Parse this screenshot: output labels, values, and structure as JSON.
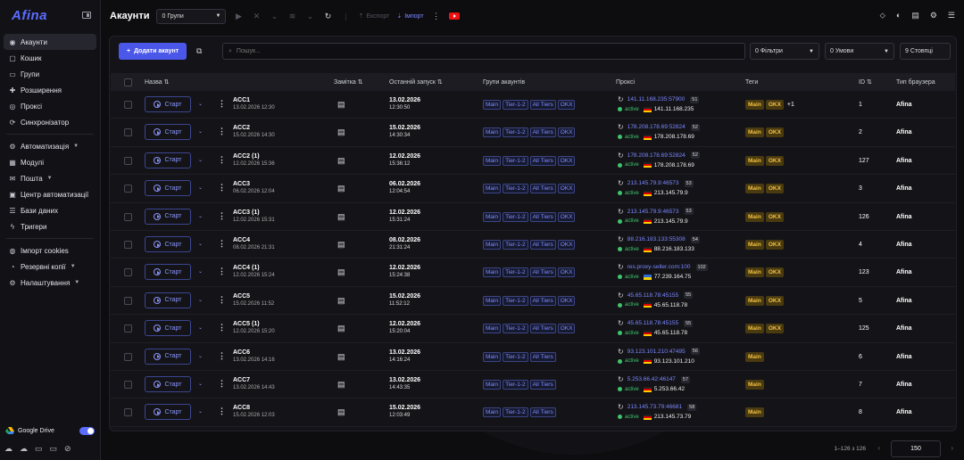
{
  "sidebar": {
    "logo": "Afina",
    "items": [
      {
        "label": "Акаунти",
        "icon": "user-icon",
        "active": true
      },
      {
        "label": "Кошик",
        "icon": "trash-icon"
      },
      {
        "label": "Групи",
        "icon": "folder-icon"
      },
      {
        "label": "Розширення",
        "icon": "puzzle-icon"
      },
      {
        "label": "Проксі",
        "icon": "globe-icon"
      },
      {
        "label": "Синхронізатор",
        "icon": "sync-icon"
      },
      {
        "label": "Автоматизація",
        "icon": "robot-icon",
        "has_chevron": true
      },
      {
        "label": "Модулі",
        "icon": "module-icon"
      },
      {
        "label": "Пошта",
        "icon": "mail-icon",
        "has_chevron": true
      },
      {
        "label": "Центр автоматизації",
        "icon": "hub-icon"
      },
      {
        "label": "Бази даних",
        "icon": "database-icon"
      },
      {
        "label": "Тригери",
        "icon": "bolt-icon"
      },
      {
        "label": "Імпорт cookies",
        "icon": "cookie-icon"
      },
      {
        "label": "Резервні копії",
        "icon": "backup-icon",
        "has_chevron": true
      },
      {
        "label": "Налаштування",
        "icon": "settings-icon",
        "has_chevron": true
      }
    ],
    "google_drive": {
      "label": "Google Drive",
      "enabled": true
    }
  },
  "topbar": {
    "title": "Акаунти",
    "group_select": "0 Групи",
    "export_label": "Експорт",
    "import_label": "Імпорт"
  },
  "toolbar": {
    "add_label": "Додати акаунт",
    "search_placeholder": "Пошук...",
    "filters": "0 Фільтри",
    "conditions": "0 Умови",
    "columns": "9 Стовпці"
  },
  "table": {
    "headers": {
      "name": "Назва",
      "note": "Замітка",
      "last_run": "Останній запуск",
      "groups": "Групи акаунтів",
      "proxy": "Проксі",
      "tags": "Теги",
      "id": "ID",
      "browser": "Тип браузера"
    },
    "start_label": "Старт",
    "status_label": "active",
    "rows": [
      {
        "name": "ACC1",
        "created": "13.02.2026 12:30",
        "run_date": "13.02.2026",
        "run_time": "12:30:50",
        "groups": [
          "Main",
          "Tier-1-2",
          "All Tiers",
          "OKX"
        ],
        "proxy": "141.11.168.235:57900",
        "pn": "51",
        "ip": "141.11.168.235",
        "flag": "de",
        "tags": [
          "Main",
          "OKX"
        ],
        "more": "+1",
        "id": "1",
        "browser": "Afina"
      },
      {
        "name": "ACC2",
        "created": "15.02.2026 14:30",
        "run_date": "15.02.2026",
        "run_time": "14:30:34",
        "groups": [
          "Main",
          "Tier-1-2",
          "All Tiers",
          "OKX"
        ],
        "proxy": "178.208.178.69:52824",
        "pn": "52",
        "ip": "178.208.178.69",
        "flag": "de",
        "tags": [
          "Main",
          "OKX"
        ],
        "more": "",
        "id": "2",
        "browser": "Afina"
      },
      {
        "name": "ACC2 (1)",
        "created": "12.02.2026 15:36",
        "run_date": "12.02.2026",
        "run_time": "15:36:12",
        "groups": [
          "Main",
          "Tier-1-2",
          "All Tiers",
          "OKX"
        ],
        "proxy": "178.208.178.69:52824",
        "pn": "52",
        "ip": "178.208.178.69",
        "flag": "de",
        "tags": [
          "Main",
          "OKX"
        ],
        "more": "",
        "id": "127",
        "browser": "Afina"
      },
      {
        "name": "ACC3",
        "created": "06.02.2026 12:04",
        "run_date": "06.02.2026",
        "run_time": "12:04:54",
        "groups": [
          "Main",
          "Tier-1-2",
          "All Tiers",
          "OKX"
        ],
        "proxy": "213.145.79.9:46573",
        "pn": "53",
        "ip": "213.145.79.9",
        "flag": "de",
        "tags": [
          "Main",
          "OKX"
        ],
        "more": "",
        "id": "3",
        "browser": "Afina"
      },
      {
        "name": "ACC3 (1)",
        "created": "12.02.2026 15:31",
        "run_date": "12.02.2026",
        "run_time": "15:31:24",
        "groups": [
          "Main",
          "Tier-1-2",
          "All Tiers",
          "OKX"
        ],
        "proxy": "213.145.79.9:46573",
        "pn": "53",
        "ip": "213.145.79.9",
        "flag": "de",
        "tags": [
          "Main",
          "OKX"
        ],
        "more": "",
        "id": "126",
        "browser": "Afina"
      },
      {
        "name": "ACC4",
        "created": "08.02.2026 21:31",
        "run_date": "08.02.2026",
        "run_time": "21:31:24",
        "groups": [
          "Main",
          "Tier-1-2",
          "All Tiers",
          "OKX"
        ],
        "proxy": "88.216.183.133:55308",
        "pn": "54",
        "ip": "88.216.183.133",
        "flag": "de",
        "tags": [
          "Main",
          "OKX"
        ],
        "more": "",
        "id": "4",
        "browser": "Afina"
      },
      {
        "name": "ACC4 (1)",
        "created": "12.02.2026 15:24",
        "run_date": "12.02.2026",
        "run_time": "15:24:38",
        "groups": [
          "Main",
          "Tier-1-2",
          "All Tiers",
          "OKX"
        ],
        "proxy": "res.proxy-seller.com:100",
        "pn": "102",
        "ip": "77.239.164.75",
        "flag": "ua",
        "tags": [
          "Main",
          "OKX"
        ],
        "more": "",
        "id": "123",
        "browser": "Afina"
      },
      {
        "name": "ACC5",
        "created": "15.02.2026 11:52",
        "run_date": "15.02.2026",
        "run_time": "11:52:12",
        "groups": [
          "Main",
          "Tier-1-2",
          "All Tiers",
          "OKX"
        ],
        "proxy": "45.65.118.78:45155",
        "pn": "55",
        "ip": "45.65.118.78",
        "flag": "de",
        "tags": [
          "Main",
          "OKX"
        ],
        "more": "",
        "id": "5",
        "browser": "Afina"
      },
      {
        "name": "ACC5 (1)",
        "created": "12.02.2026 15:20",
        "run_date": "12.02.2026",
        "run_time": "15:20:04",
        "groups": [
          "Main",
          "Tier-1-2",
          "All Tiers",
          "OKX"
        ],
        "proxy": "45.65.118.78:45155",
        "pn": "55",
        "ip": "45.65.118.78",
        "flag": "de",
        "tags": [
          "Main",
          "OKX"
        ],
        "more": "",
        "id": "125",
        "browser": "Afina"
      },
      {
        "name": "ACC6",
        "created": "13.02.2026 14:16",
        "run_date": "13.02.2026",
        "run_time": "14:16:24",
        "groups": [
          "Main",
          "Tier-1-2",
          "All Tiers"
        ],
        "proxy": "93.123.101.210:47495",
        "pn": "56",
        "ip": "93.123.101.210",
        "flag": "de",
        "tags": [
          "Main"
        ],
        "more": "",
        "id": "6",
        "browser": "Afina"
      },
      {
        "name": "ACC7",
        "created": "13.02.2026 14:43",
        "run_date": "13.02.2026",
        "run_time": "14:43:35",
        "groups": [
          "Main",
          "Tier-1-2",
          "All Tiers"
        ],
        "proxy": "5.253.66.42:46147",
        "pn": "57",
        "ip": "5.253.66.42",
        "flag": "de",
        "tags": [
          "Main"
        ],
        "more": "",
        "id": "7",
        "browser": "Afina"
      },
      {
        "name": "ACC8",
        "created": "15.02.2026 12:03",
        "run_date": "15.02.2026",
        "run_time": "12:03:49",
        "groups": [
          "Main",
          "Tier-1-2",
          "All Tiers"
        ],
        "proxy": "213.145.73.79:46681",
        "pn": "58",
        "ip": "213.145.73.79",
        "flag": "de",
        "tags": [
          "Main"
        ],
        "more": "",
        "id": "8",
        "browser": "Afina"
      }
    ]
  },
  "pagination": {
    "range": "1–126 з 126",
    "per_page": "150"
  },
  "colors": {
    "accent": "#4b57e8",
    "link": "#7b86ff",
    "status": "#3ec46d",
    "tag": "#f0c040"
  }
}
